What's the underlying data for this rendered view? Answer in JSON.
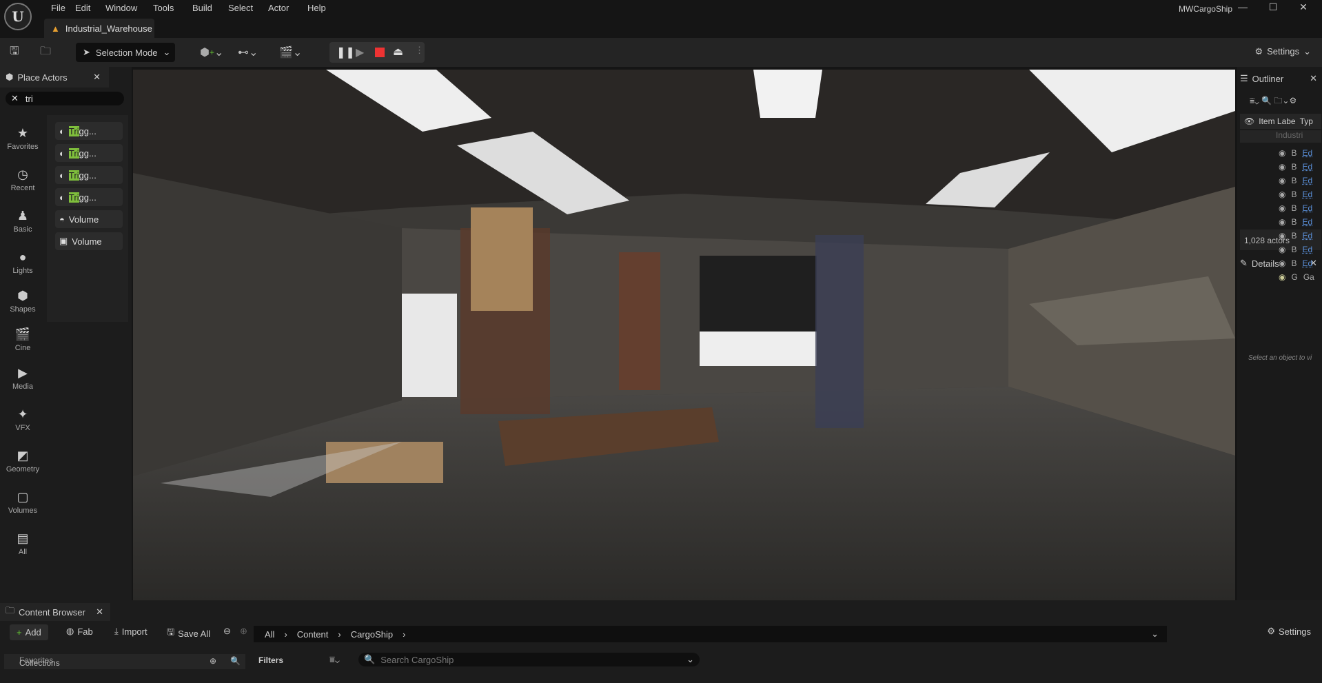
{
  "menu": [
    "File",
    "Edit",
    "Window",
    "Tools",
    "Build",
    "Select",
    "Actor",
    "Help"
  ],
  "level_tab": "Industrial_Warehouse",
  "project_name": "MWCargoShip",
  "toolbar": {
    "selection_mode": "Selection Mode",
    "settings": "Settings"
  },
  "place_actors": {
    "title": "Place Actors",
    "search_value": "tri",
    "categories": [
      "Favorites",
      "Recent",
      "Basic",
      "Lights",
      "Shapes",
      "Cine",
      "Media",
      "VFX",
      "Geometry",
      "Volumes",
      "All"
    ],
    "items": [
      {
        "match": "Tri",
        "rest": "gg..."
      },
      {
        "match": "Tri",
        "rest": "gg..."
      },
      {
        "match": "Tri",
        "rest": "gg..."
      },
      {
        "match": "Tri",
        "rest": "gg..."
      },
      {
        "match": "",
        "rest": "Volume"
      },
      {
        "match": "",
        "rest": "Volume"
      }
    ]
  },
  "outliner": {
    "title": "Outliner",
    "col_label": "Item Labe",
    "col_type": "Typ",
    "root": "Industri",
    "rows": [
      [
        "B",
        "Ed"
      ],
      [
        "B",
        "Ed"
      ],
      [
        "B",
        "Ed"
      ],
      [
        "B",
        "Ed"
      ],
      [
        "B",
        "Ed"
      ],
      [
        "B",
        "Ed"
      ],
      [
        "B",
        "Ed"
      ],
      [
        "B",
        "Ed"
      ],
      [
        "B",
        "Ed"
      ],
      [
        "G",
        "Ga"
      ]
    ],
    "count": "1,028 actors"
  },
  "details": {
    "title": "Details",
    "empty": "Select an object to vi"
  },
  "content_browser": {
    "title": "Content Browser",
    "add": "Add",
    "fab": "Fab",
    "import": "Import",
    "save_all": "Save All",
    "breadcrumb": [
      "All",
      "Content",
      "CargoShip"
    ],
    "settings": "Settings",
    "favorites": "Favorites",
    "collections": "Collections",
    "filters": "Filters",
    "search_placeholder": "Search CargoShip"
  }
}
